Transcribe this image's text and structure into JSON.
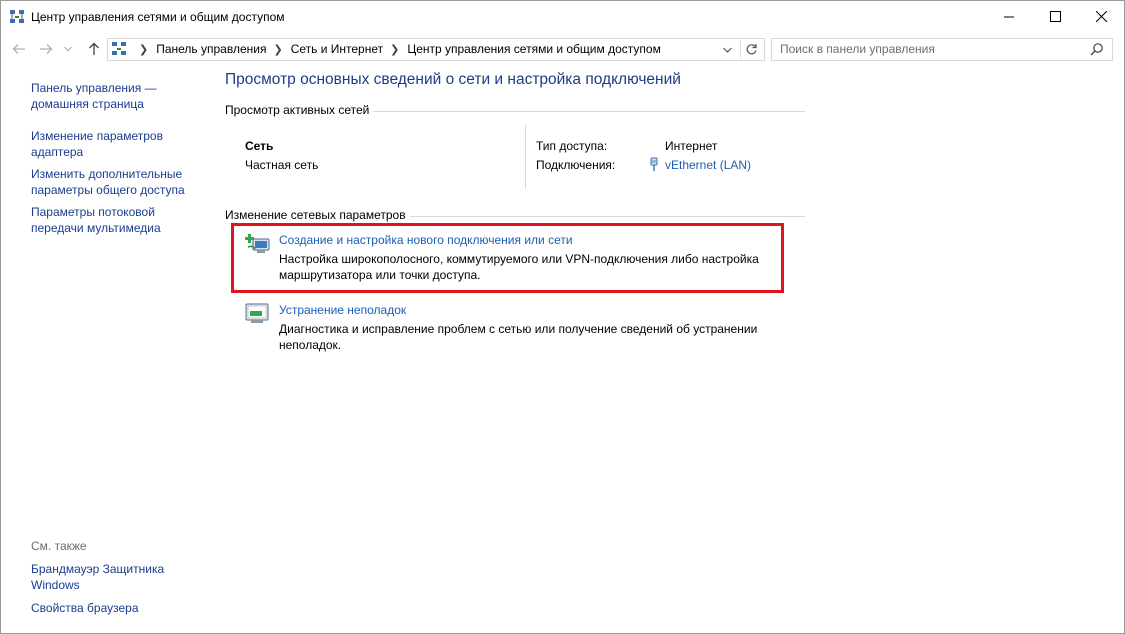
{
  "window": {
    "title": "Центр управления сетями и общим доступом",
    "icon": "network-center-icon",
    "controls": [
      "minimize-icon",
      "maximize-icon",
      "close-icon"
    ]
  },
  "address": {
    "breadcrumbs": [
      "Панель управления",
      "Сеть и Интернет",
      "Центр управления сетями и общим доступом"
    ],
    "search_placeholder": "Поиск в панели управления"
  },
  "sidebar": {
    "links": [
      {
        "label_line1": "Панель управления —",
        "label_line2": "домашняя страница"
      },
      {
        "label_line1": "Изменение параметров",
        "label_line2": "адаптера"
      },
      {
        "label_line1": "Изменить дополнительные",
        "label_line2": "параметры общего доступа"
      },
      {
        "label_line1": "Параметры потоковой",
        "label_line2": "передачи мультимедиа"
      }
    ],
    "see_also": {
      "header": "См. также",
      "links": [
        {
          "label_line1": "Брандмауэр Защитника",
          "label_line2": "Windows"
        },
        {
          "label_line1": "Свойства браузера",
          "label_line2": ""
        }
      ]
    }
  },
  "main": {
    "title": "Просмотр основных сведений о сети и настройка подключений",
    "active_networks": {
      "header": "Просмотр активных сетей",
      "network_name": "Сеть",
      "network_type": "Частная сеть",
      "access_type_label": "Тип доступа:",
      "access_type_value": "Интернет",
      "connections_label": "Подключения:",
      "connections_value": "vEthernet (LAN)"
    },
    "change_settings": {
      "header": "Изменение сетевых параметров",
      "tasks": [
        {
          "link": "Создание и настройка нового подключения или сети",
          "desc_line1": "Настройка широкополосного, коммутируемого или VPN-подключения либо настройка",
          "desc_line2": "маршрутизатора или точки доступа."
        },
        {
          "link": "Устранение неполадок",
          "desc_line1": "Диагностика и исправление проблем с сетью или получение сведений об устранении",
          "desc_line2": "неполадок."
        }
      ]
    }
  },
  "colors": {
    "link": "#1a5fb4",
    "title": "#1e3b86",
    "highlight": "#e0131e"
  }
}
